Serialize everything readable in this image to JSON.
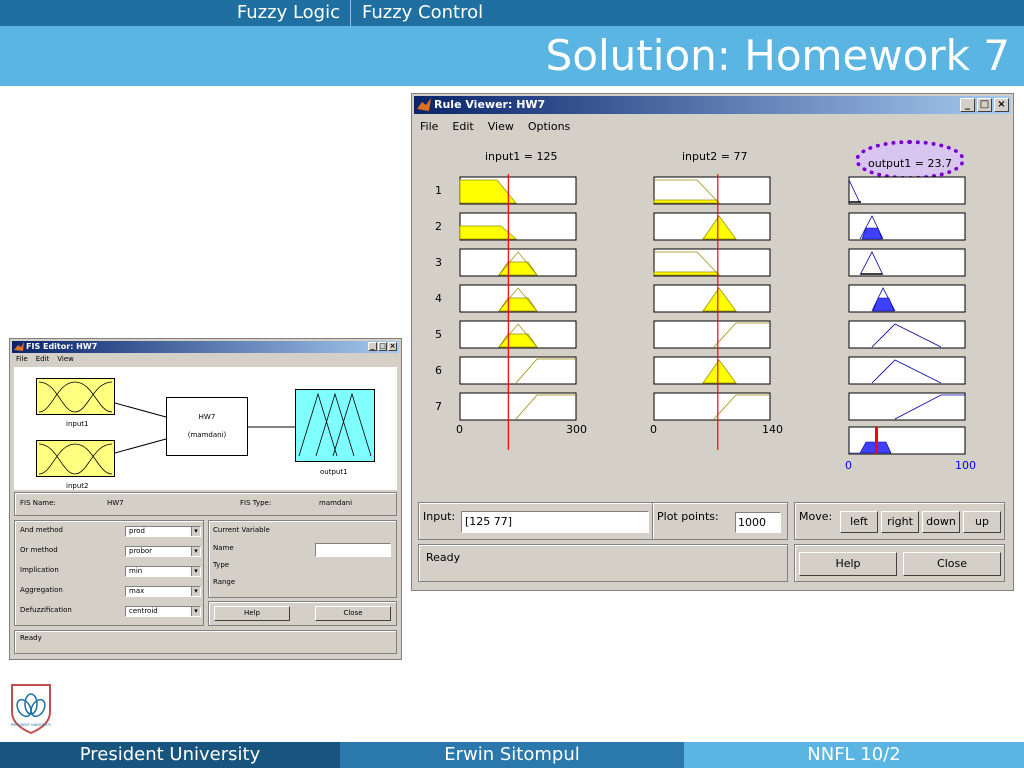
{
  "slide": {
    "nav_left": "Fuzzy Logic",
    "nav_right": "Fuzzy Control",
    "title": "Solution: Homework 7",
    "footer_left": "President University",
    "footer_center": "Erwin Sitompul",
    "footer_right": "NNFL 10/2",
    "logo_text": "PRESIDENT UNIVERSITY",
    "colors": {
      "nav": "#1f6fa1",
      "title_band": "#5bb5e2",
      "footer_dark": "#17557e",
      "footer_mid": "#2b78ad",
      "footer_light": "#5bb5e2"
    }
  },
  "fis_editor": {
    "title": "FIS Editor: HW7",
    "menu": [
      "File",
      "Edit",
      "View"
    ],
    "window_buttons": [
      "_",
      "□",
      "×"
    ],
    "input1_label": "input1",
    "input2_label": "input2",
    "output_label": "output1",
    "system_name": "HW7",
    "system_type_paren": "(mamdani)",
    "fis_name_label": "FIS Name:",
    "fis_name_value": "HW7",
    "fis_type_label": "FIS Type:",
    "fis_type_value": "mamdani",
    "methods": [
      {
        "label": "And method",
        "value": "prod"
      },
      {
        "label": "Or method",
        "value": "probor"
      },
      {
        "label": "Implication",
        "value": "min"
      },
      {
        "label": "Aggregation",
        "value": "max"
      },
      {
        "label": "Defuzzification",
        "value": "centroid"
      }
    ],
    "current_variable_label": "Current Variable",
    "name_label": "Name",
    "type_label": "Type",
    "range_label": "Range",
    "help_button": "Help",
    "close_button": "Close",
    "status": "Ready",
    "colors": {
      "input_mf_box": "#ffff80",
      "output_mf_box": "#80ffff"
    }
  },
  "rule_viewer": {
    "title": "Rule Viewer: HW7",
    "menu": [
      "File",
      "Edit",
      "View",
      "Options"
    ],
    "window_buttons": [
      "_",
      "□",
      "×"
    ],
    "input1_header": "input1 = 125",
    "input2_header": "input2 = 77",
    "output_header": "output1 = 23.7",
    "rule_numbers": [
      "1",
      "2",
      "3",
      "4",
      "5",
      "6",
      "7"
    ],
    "input1_axis": {
      "min": "0",
      "max": "300"
    },
    "input2_axis": {
      "min": "0",
      "max": "140"
    },
    "output_axis": {
      "min": "0",
      "max": "100"
    },
    "input1_value": 125,
    "input2_value": 77,
    "output_value": 23.7,
    "input_label": "Input:",
    "input_value": "[125 77]",
    "plot_points_label": "Plot points:",
    "plot_points_value": "1000",
    "move_label": "Move:",
    "move_buttons": [
      "left",
      "right",
      "down",
      "up"
    ],
    "help_button": "Help",
    "close_button": "Close",
    "status": "Ready",
    "colors": {
      "antecedent_fill": "#ffff00",
      "consequent_fill": "#4040ff",
      "consequent_line": "#0000a0",
      "marker": "#ff0000",
      "highlight": "#7a00cc"
    }
  }
}
